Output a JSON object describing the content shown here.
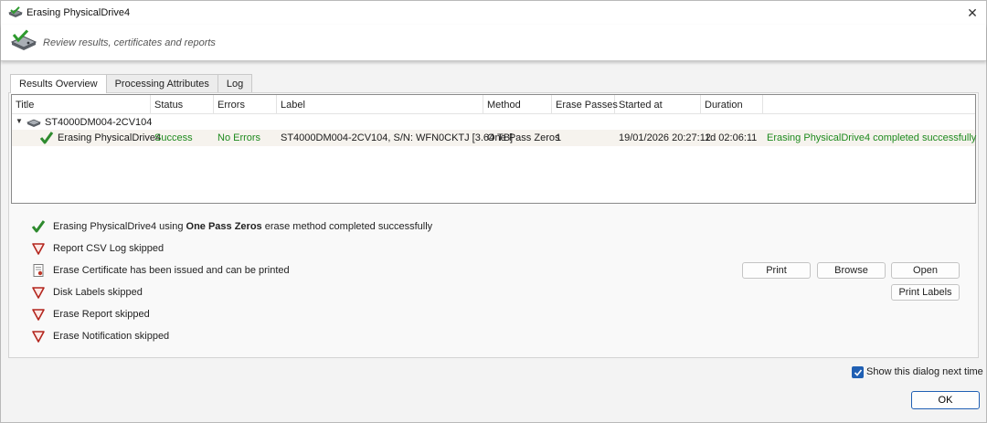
{
  "window": {
    "title": "Erasing PhysicalDrive4",
    "close_glyph": "✕"
  },
  "header": {
    "subtitle": "Review results, certificates and reports"
  },
  "tabs": [
    {
      "label": "Results Overview",
      "active": true
    },
    {
      "label": "Processing Attributes",
      "active": false
    },
    {
      "label": "Log",
      "active": false
    }
  ],
  "grid": {
    "columns": [
      "Title",
      "Status",
      "Errors",
      "Label",
      "Method",
      "Erase Passes",
      "Started at",
      "Duration",
      ""
    ],
    "parent": {
      "title": "ST4000DM004-2CV104"
    },
    "row": {
      "title": "Erasing PhysicalDrive4",
      "status": "Success",
      "errors": "No Errors",
      "label": "ST4000DM004-2CV104, S/N: WFN0CKTJ [3.64 TB]",
      "method": "One Pass Zeros",
      "passes": "1",
      "started": "19/01/2026 20:27:12",
      "duration": "1d 02:06:11",
      "message": "Erasing PhysicalDrive4 completed successfully"
    }
  },
  "actions": {
    "completed": {
      "prefix": "Erasing PhysicalDrive4 using ",
      "method": "One Pass Zeros",
      "suffix": " erase method completed successfully"
    },
    "csv_log": "Report CSV Log skipped",
    "certificate": "Erase Certificate has been issued and can be printed",
    "disk_labels": "Disk Labels skipped",
    "erase_report": "Erase Report skipped",
    "notification": "Erase Notification skipped"
  },
  "buttons": {
    "print": "Print",
    "browse": "Browse",
    "open": "Open",
    "print_labels": "Print Labels",
    "ok": "OK"
  },
  "footer": {
    "show_dialog": "Show this dialog next time",
    "show_dialog_checked": true
  },
  "colors": {
    "success": "#1e8a1e",
    "accent": "#1f5fb3",
    "skip": "#b3261e"
  },
  "icons": {
    "app": "drive-check-icon",
    "success": "green-check-icon",
    "skipped": "red-triangle-icon",
    "certificate": "certificate-icon",
    "drive": "hard-drive-icon"
  }
}
